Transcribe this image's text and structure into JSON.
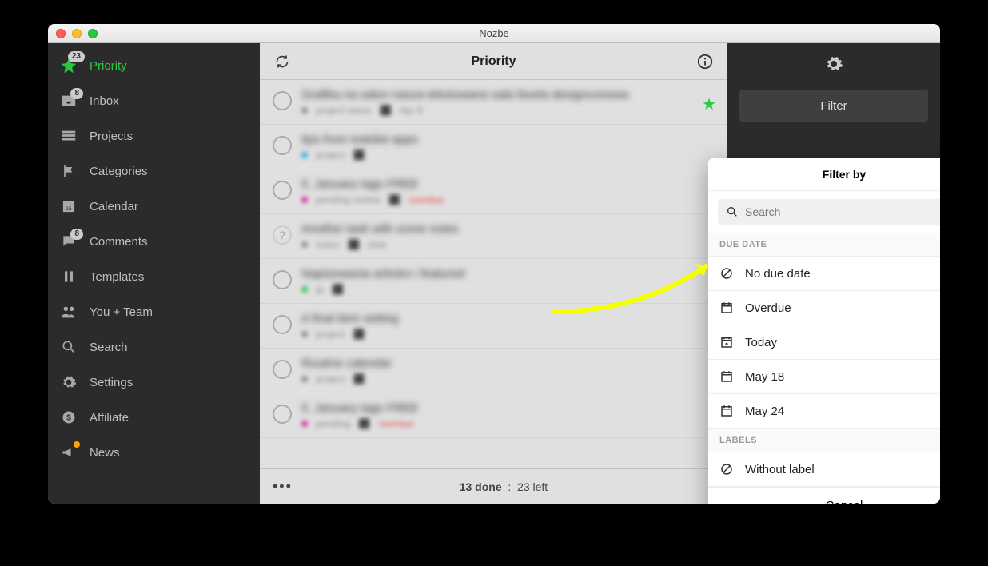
{
  "window": {
    "title": "Nozbe"
  },
  "sidebar": {
    "items": [
      {
        "label": "Priority",
        "badge": "23"
      },
      {
        "label": "Inbox",
        "badge": "8"
      },
      {
        "label": "Projects"
      },
      {
        "label": "Categories"
      },
      {
        "label": "Calendar"
      },
      {
        "label": "Comments",
        "badge": "8"
      },
      {
        "label": "Templates"
      },
      {
        "label": "You + Team"
      },
      {
        "label": "Search"
      },
      {
        "label": "Settings"
      },
      {
        "label": "Affiliate"
      },
      {
        "label": "News"
      }
    ]
  },
  "main": {
    "title": "Priority",
    "tasks": [
      {
        "dot": "#888"
      },
      {
        "dot": "#2aa9e0"
      },
      {
        "dot": "#d6249f"
      },
      {
        "dot": "#888"
      },
      {
        "dot": "#28c840"
      },
      {
        "dot": "#888"
      },
      {
        "dot": "#888"
      },
      {
        "dot": "#d6249f"
      }
    ],
    "footer": {
      "done": "13 done",
      "left": "23 left"
    }
  },
  "rightPanel": {
    "filter_label": "Filter"
  },
  "popover": {
    "title": "Filter by",
    "search_placeholder": "Search",
    "sections": {
      "due_date_label": "DUE DATE",
      "labels_label": "LABELS"
    },
    "due_items": [
      {
        "label": "No due date"
      },
      {
        "label": "Overdue"
      },
      {
        "label": "Today"
      },
      {
        "label": "May 18"
      },
      {
        "label": "May 24"
      }
    ],
    "label_items": [
      {
        "label": "Without label"
      }
    ],
    "cancel": "Cancel"
  }
}
